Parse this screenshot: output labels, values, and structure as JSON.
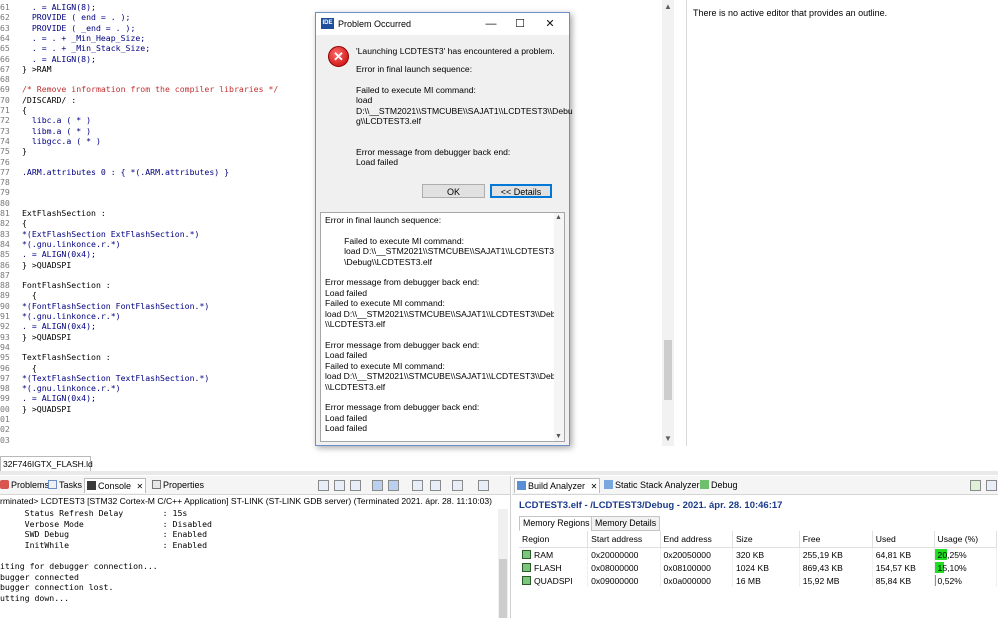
{
  "editor": {
    "lines": [
      {
        "n": "61",
        "segs": [
          {
            "t": "  . = ALIGN(8);",
            "c": "name"
          }
        ]
      },
      {
        "n": "62",
        "segs": [
          {
            "t": "  PROVIDE ( end = . );",
            "c": "name"
          }
        ]
      },
      {
        "n": "63",
        "segs": [
          {
            "t": "  PROVIDE ( _end = . );",
            "c": "name"
          }
        ]
      },
      {
        "n": "64",
        "segs": [
          {
            "t": "  . = . + _Min_Heap_Size;",
            "c": "name"
          }
        ]
      },
      {
        "n": "65",
        "segs": [
          {
            "t": "  . = . + _Min_Stack_Size;",
            "c": "name"
          }
        ]
      },
      {
        "n": "66",
        "segs": [
          {
            "t": "  . = ALIGN(8);",
            "c": "name"
          }
        ]
      },
      {
        "n": "67",
        "segs": [
          {
            "t": "} >RAM",
            "c": "plain"
          }
        ]
      },
      {
        "n": "68",
        "segs": [
          {
            "t": "",
            "c": "plain"
          }
        ]
      },
      {
        "n": "69",
        "segs": [
          {
            "t": "/* Remove information from the compiler libraries */",
            "c": "cmt"
          }
        ]
      },
      {
        "n": "70",
        "segs": [
          {
            "t": "/DISCARD/ :",
            "c": "plain"
          }
        ]
      },
      {
        "n": "71",
        "segs": [
          {
            "t": "{",
            "c": "plain"
          }
        ]
      },
      {
        "n": "72",
        "segs": [
          {
            "t": "  libc.a ( * )",
            "c": "name"
          }
        ]
      },
      {
        "n": "73",
        "segs": [
          {
            "t": "  libm.a ( * )",
            "c": "name"
          }
        ]
      },
      {
        "n": "74",
        "segs": [
          {
            "t": "  libgcc.a ( * )",
            "c": "name"
          }
        ]
      },
      {
        "n": "75",
        "segs": [
          {
            "t": "}",
            "c": "plain"
          }
        ]
      },
      {
        "n": "76",
        "segs": [
          {
            "t": "",
            "c": "plain"
          }
        ]
      },
      {
        "n": "77",
        "segs": [
          {
            "t": ".ARM.attributes 0 : { *(.ARM.attributes) }",
            "c": "name"
          }
        ]
      },
      {
        "n": "78",
        "segs": [
          {
            "t": "",
            "c": "plain"
          }
        ]
      },
      {
        "n": "79",
        "segs": [
          {
            "t": "",
            "c": "plain"
          }
        ]
      },
      {
        "n": "80",
        "segs": [
          {
            "t": "",
            "c": "plain"
          }
        ]
      },
      {
        "n": "81",
        "segs": [
          {
            "t": "ExtFlashSection :",
            "c": "plain"
          }
        ]
      },
      {
        "n": "82",
        "segs": [
          {
            "t": "{",
            "c": "plain"
          }
        ]
      },
      {
        "n": "83",
        "segs": [
          {
            "t": "*(ExtFlashSection ExtFlashSection.*)",
            "c": "name"
          }
        ]
      },
      {
        "n": "84",
        "segs": [
          {
            "t": "*(.gnu.linkonce.r.*)",
            "c": "name"
          }
        ]
      },
      {
        "n": "85",
        "segs": [
          {
            "t": ". = ALIGN(0x4);",
            "c": "name"
          }
        ]
      },
      {
        "n": "86",
        "segs": [
          {
            "t": "} >QUADSPI",
            "c": "plain"
          }
        ]
      },
      {
        "n": "87",
        "segs": [
          {
            "t": "",
            "c": "plain"
          }
        ]
      },
      {
        "n": "88",
        "segs": [
          {
            "t": "FontFlashSection :",
            "c": "plain"
          }
        ]
      },
      {
        "n": "89",
        "segs": [
          {
            "t": "  {",
            "c": "plain"
          }
        ]
      },
      {
        "n": "90",
        "segs": [
          {
            "t": "*(FontFlashSection FontFlashSection.*)",
            "c": "name"
          }
        ]
      },
      {
        "n": "91",
        "segs": [
          {
            "t": "*(.gnu.linkonce.r.*)",
            "c": "name"
          }
        ]
      },
      {
        "n": "92",
        "segs": [
          {
            "t": ". = ALIGN(0x4);",
            "c": "name"
          }
        ]
      },
      {
        "n": "93",
        "segs": [
          {
            "t": "} >QUADSPI",
            "c": "plain"
          }
        ]
      },
      {
        "n": "94",
        "segs": [
          {
            "t": "",
            "c": "plain"
          }
        ]
      },
      {
        "n": "95",
        "segs": [
          {
            "t": "TextFlashSection :",
            "c": "plain"
          }
        ]
      },
      {
        "n": "96",
        "segs": [
          {
            "t": "  {",
            "c": "plain"
          }
        ]
      },
      {
        "n": "97",
        "segs": [
          {
            "t": "*(TextFlashSection TextFlashSection.*)",
            "c": "name"
          }
        ]
      },
      {
        "n": "98",
        "segs": [
          {
            "t": "*(.gnu.linkonce.r.*)",
            "c": "name"
          }
        ]
      },
      {
        "n": "99",
        "segs": [
          {
            "t": ". = ALIGN(0x4);",
            "c": "name"
          }
        ]
      },
      {
        "n": "00",
        "segs": [
          {
            "t": "} >QUADSPI",
            "c": "plain"
          }
        ]
      },
      {
        "n": "01",
        "segs": [
          {
            "t": "",
            "c": "plain"
          }
        ]
      },
      {
        "n": "02",
        "segs": [
          {
            "t": "",
            "c": "plain"
          }
        ]
      },
      {
        "n": "03",
        "segs": [
          {
            "t": "",
            "c": "plain"
          }
        ]
      }
    ],
    "tab_label": "32F746IGTX_FLASH.ld"
  },
  "outline": {
    "message": "There is no active editor that provides an outline."
  },
  "dialog": {
    "title": "Problem Occurred",
    "app_icon_text": "IDE",
    "heading": "'Launching LCDTEST3' has encountered a problem.",
    "sub_heading": "Error in final launch sequence:",
    "msg1": "Failed to execute MI command:\nload\nD:\\\\__STM2021\\\\STMCUBE\\\\SAJAT1\\\\LCDTEST3\\\\Debu\ng\\\\LCDTEST3.elf",
    "msg2": "Error message from debugger back end:\nLoad failed",
    "ok_label": "OK",
    "details_label": "<< Details",
    "details_text": "Error in final launch sequence:\n\n        Failed to execute MI command:\n        load D:\\\\__STM2021\\\\STMCUBE\\\\SAJAT1\\\\LCDTEST3\\\n        \\Debug\\\\LCDTEST3.elf\n\nError message from debugger back end:\nLoad failed\nFailed to execute MI command:\nload D:\\\\__STM2021\\\\STMCUBE\\\\SAJAT1\\\\LCDTEST3\\\\Debug\n\\\\LCDTEST3.elf\n\nError message from debugger back end:\nLoad failed\nFailed to execute MI command:\nload D:\\\\__STM2021\\\\STMCUBE\\\\SAJAT1\\\\LCDTEST3\\\\Debug\n\\\\LCDTEST3.elf\n\nError message from debugger back end:\nLoad failed\nLoad failed"
  },
  "console_panel": {
    "tabs": [
      {
        "label": "Problems",
        "icon": "problems-icon",
        "active": false
      },
      {
        "label": "Tasks",
        "icon": "tasks-icon",
        "active": false
      },
      {
        "label": "Console",
        "icon": "console-icon",
        "active": true
      },
      {
        "label": "Properties",
        "icon": "properties-icon",
        "active": false
      }
    ],
    "close_glyph": "✕",
    "status": "rminated> LCDTEST3 [STM32 Cortex-M C/C++ Application] ST-LINK (ST-LINK GDB server) (Terminated 2021. ápr. 28. 11:10:03)",
    "lines": [
      "     Status Refresh Delay        : 15s",
      "     Verbose Mode                : Disabled",
      "     SWD Debug                   : Enabled",
      "     InitWhile                   : Enabled",
      "",
      "iting for debugger connection...",
      "bugger connected",
      "bugger connection lost.",
      "utting down..."
    ]
  },
  "build_panel": {
    "tabs": [
      {
        "label": "Build Analyzer",
        "icon": "build-analyzer-icon",
        "active": true
      },
      {
        "label": "Static Stack Analyzer",
        "icon": "stack-analyzer-icon",
        "active": false
      },
      {
        "label": "Debug",
        "icon": "debug-icon",
        "active": false
      }
    ],
    "close_glyph": "✕",
    "title": "LCDTEST3.elf - /LCDTEST3/Debug - 2021. ápr. 28. 10:46:17",
    "subtabs": [
      "Memory Regions",
      "Memory Details"
    ],
    "columns": [
      "Region",
      "Start address",
      "End address",
      "Size",
      "Free",
      "Used",
      "Usage (%)"
    ],
    "rows": [
      {
        "region": "RAM",
        "start": "0x20000000",
        "end": "0x20050000",
        "size": "320 KB",
        "free": "255,19 KB",
        "used": "64,81 KB",
        "usage": "20,25%",
        "usage_value": 20.25
      },
      {
        "region": "FLASH",
        "start": "0x08000000",
        "end": "0x08100000",
        "size": "1024 KB",
        "free": "869,43 KB",
        "used": "154,57 KB",
        "usage": "15,10%",
        "usage_value": 15.1
      },
      {
        "region": "QUADSPI",
        "start": "0x09000000",
        "end": "0x0a000000",
        "size": "16 MB",
        "free": "15,92 MB",
        "used": "85,84 KB",
        "usage": "0,52%",
        "usage_value": 0.52
      }
    ],
    "bar_color": "#22dd22"
  }
}
